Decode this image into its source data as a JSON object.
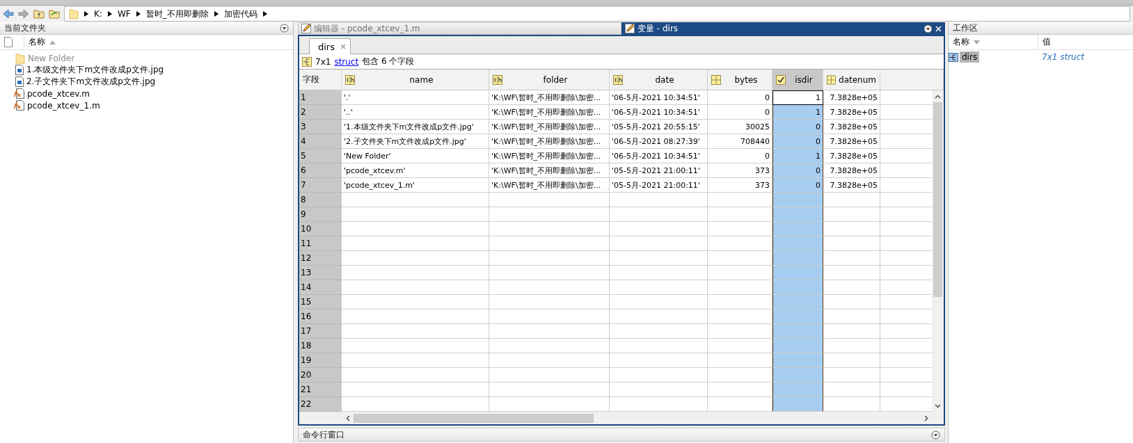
{
  "address_bar": {
    "segments": [
      "K:",
      "WF",
      "暂时_不用即删除",
      "加密代码"
    ]
  },
  "current_folder": {
    "title": "当前文件夹",
    "column": "名称",
    "files": [
      {
        "name": "New Folder",
        "kind": "folder",
        "dimmed": true
      },
      {
        "name": "1.本级文件夹下m文件改成p文件.jpg",
        "kind": "image",
        "dimmed": false
      },
      {
        "name": "2.子文件夹下m文件改成p文件.jpg",
        "kind": "image",
        "dimmed": false
      },
      {
        "name": "pcode_xtcev.m",
        "kind": "mfile",
        "dimmed": false
      },
      {
        "name": "pcode_xtcev_1.m",
        "kind": "mfile",
        "dimmed": false
      }
    ]
  },
  "editor_tabs": [
    {
      "label": "编辑器 - pcode_xtcev_1.m",
      "selected": false
    },
    {
      "label": "变量 - dirs",
      "selected": true
    }
  ],
  "variable_editor": {
    "doc_tab": "dirs",
    "summary_size": "7x1",
    "summary_link": "struct",
    "summary_rest": "包含 6 个字段",
    "index_header": "字段",
    "columns": [
      {
        "name": "name",
        "kind": "char",
        "selected": false
      },
      {
        "name": "folder",
        "kind": "char",
        "selected": false
      },
      {
        "name": "date",
        "kind": "char",
        "selected": false
      },
      {
        "name": "bytes",
        "kind": "numeric",
        "selected": false
      },
      {
        "name": "isdir",
        "kind": "logical",
        "selected": true
      },
      {
        "name": "datenum",
        "kind": "numeric",
        "selected": false
      }
    ],
    "rows": [
      {
        "index": "1",
        "focused": true,
        "cells": [
          "'.'",
          "'K:\\WF\\暂时_不用即删除\\加密...",
          "'06-5月-2021 10:34:51'",
          "0",
          "1",
          "7.3828e+05"
        ]
      },
      {
        "index": "2",
        "focused": false,
        "cells": [
          "'..'",
          "'K:\\WF\\暂时_不用即删除\\加密...",
          "'06-5月-2021 10:34:51'",
          "0",
          "1",
          "7.3828e+05"
        ]
      },
      {
        "index": "3",
        "focused": false,
        "cells": [
          "'1.本级文件夹下m文件改成p文件.jpg'",
          "'K:\\WF\\暂时_不用即删除\\加密...",
          "'05-5月-2021 20:55:15'",
          "30025",
          "0",
          "7.3828e+05"
        ]
      },
      {
        "index": "4",
        "focused": false,
        "cells": [
          "'2.子文件夹下m文件改成p文件.jpg'",
          "'K:\\WF\\暂时_不用即删除\\加密...",
          "'06-5月-2021 08:27:39'",
          "708440",
          "0",
          "7.3828e+05"
        ]
      },
      {
        "index": "5",
        "focused": false,
        "cells": [
          "'New Folder'",
          "'K:\\WF\\暂时_不用即删除\\加密...",
          "'06-5月-2021 10:34:51'",
          "0",
          "1",
          "7.3828e+05"
        ]
      },
      {
        "index": "6",
        "focused": false,
        "cells": [
          "'pcode_xtcev.m'",
          "'K:\\WF\\暂时_不用即删除\\加密...",
          "'05-5月-2021 21:00:11'",
          "373",
          "0",
          "7.3828e+05"
        ]
      },
      {
        "index": "7",
        "focused": false,
        "cells": [
          "'pcode_xtcev_1.m'",
          "'K:\\WF\\暂时_不用即删除\\加密...",
          "'05-5月-2021 21:00:11'",
          "373",
          "0",
          "7.3828e+05"
        ]
      },
      {
        "index": "8"
      },
      {
        "index": "9"
      },
      {
        "index": "10"
      },
      {
        "index": "11"
      },
      {
        "index": "12"
      },
      {
        "index": "13"
      },
      {
        "index": "14"
      },
      {
        "index": "15"
      },
      {
        "index": "16"
      },
      {
        "index": "17"
      },
      {
        "index": "18"
      },
      {
        "index": "19"
      },
      {
        "index": "20"
      },
      {
        "index": "21"
      },
      {
        "index": "22"
      }
    ]
  },
  "command_window": {
    "title": "命令行窗口"
  },
  "workspace": {
    "title": "工作区",
    "columns": [
      "名称",
      "值"
    ],
    "items": [
      {
        "name": "dirs",
        "value": "7x1 struct",
        "selected": true
      }
    ]
  }
}
